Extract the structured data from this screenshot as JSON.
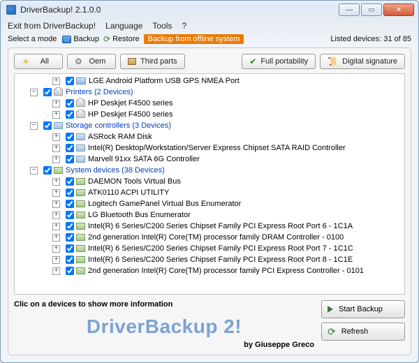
{
  "window": {
    "title": "DriverBackup! 2.1.0.0"
  },
  "menu": {
    "exit": "Exit from DriverBackup!",
    "language": "Language",
    "tools": "Tools",
    "help": "?"
  },
  "toolbar": {
    "selectModeLabel": "Select a mode",
    "backup": "Backup",
    "restore": "Restore",
    "offline": "Backup from offline system",
    "listed": "Listed devices: 31 of 85"
  },
  "filters": {
    "all": "All",
    "oem": "Oem",
    "third": "Third parts",
    "portability": "Full portability",
    "signature": "Digital signature"
  },
  "tree": {
    "rows": [
      {
        "indent": 3,
        "exp": "+",
        "chk": true,
        "icon": "mon",
        "cat": false,
        "label": "LGE Android Platform USB GPS NMEA Port"
      },
      {
        "indent": 1,
        "exp": "-",
        "chk": true,
        "icon": "prn",
        "cat": true,
        "label": "Printers   (2 Devices)"
      },
      {
        "indent": 3,
        "exp": "+",
        "chk": true,
        "icon": "prn",
        "cat": false,
        "label": "HP Deskjet F4500 series"
      },
      {
        "indent": 3,
        "exp": "+",
        "chk": true,
        "icon": "prn",
        "cat": false,
        "label": "HP Deskjet F4500 series"
      },
      {
        "indent": 1,
        "exp": "-",
        "chk": true,
        "icon": "drv",
        "cat": true,
        "label": "Storage controllers   (3 Devices)"
      },
      {
        "indent": 3,
        "exp": "+",
        "chk": true,
        "icon": "drv",
        "cat": false,
        "label": "ASRock RAM Disk"
      },
      {
        "indent": 3,
        "exp": "+",
        "chk": true,
        "icon": "drv",
        "cat": false,
        "label": "Intel(R) Desktop/Workstation/Server Express Chipset SATA RAID Controller"
      },
      {
        "indent": 3,
        "exp": "+",
        "chk": true,
        "icon": "drv",
        "cat": false,
        "label": "Marvell 91xx SATA 6G Controller"
      },
      {
        "indent": 1,
        "exp": "-",
        "chk": true,
        "icon": "chip",
        "cat": true,
        "label": "System devices   (38 Devices)"
      },
      {
        "indent": 3,
        "exp": "+",
        "chk": true,
        "icon": "chip",
        "cat": false,
        "label": "DAEMON Tools Virtual Bus"
      },
      {
        "indent": 3,
        "exp": "+",
        "chk": true,
        "icon": "chip",
        "cat": false,
        "label": "ATK0110 ACPI UTILITY"
      },
      {
        "indent": 3,
        "exp": "+",
        "chk": true,
        "icon": "chip",
        "cat": false,
        "label": "Logitech GamePanel Virtual Bus Enumerator"
      },
      {
        "indent": 3,
        "exp": "+",
        "chk": true,
        "icon": "chip",
        "cat": false,
        "label": "LG Bluetooth Bus Enumerator"
      },
      {
        "indent": 3,
        "exp": "+",
        "chk": true,
        "icon": "chip",
        "cat": false,
        "label": "Intel(R) 6 Series/C200 Series Chipset Family PCI Express Root Port 6 - 1C1A"
      },
      {
        "indent": 3,
        "exp": "+",
        "chk": true,
        "icon": "chip",
        "cat": false,
        "label": "2nd generation Intel(R) Core(TM) processor family DRAM Controller - 0100"
      },
      {
        "indent": 3,
        "exp": "+",
        "chk": true,
        "icon": "chip",
        "cat": false,
        "label": "Intel(R) 6 Series/C200 Series Chipset Family PCI Express Root Port 7 - 1C1C"
      },
      {
        "indent": 3,
        "exp": "+",
        "chk": true,
        "icon": "chip",
        "cat": false,
        "label": "Intel(R) 6 Series/C200 Series Chipset Family PCI Express Root Port 8 - 1C1E"
      },
      {
        "indent": 3,
        "exp": "+",
        "chk": true,
        "icon": "chip",
        "cat": false,
        "label": "2nd generation Intel(R) Core(TM) processor family PCI Express Controller - 0101"
      }
    ]
  },
  "bottom": {
    "info": "Clic on a devices to show more information",
    "brand": "DriverBackup 2!",
    "byline": "by Giuseppe Greco",
    "startBackup": "Start Backup",
    "refresh": "Refresh"
  }
}
